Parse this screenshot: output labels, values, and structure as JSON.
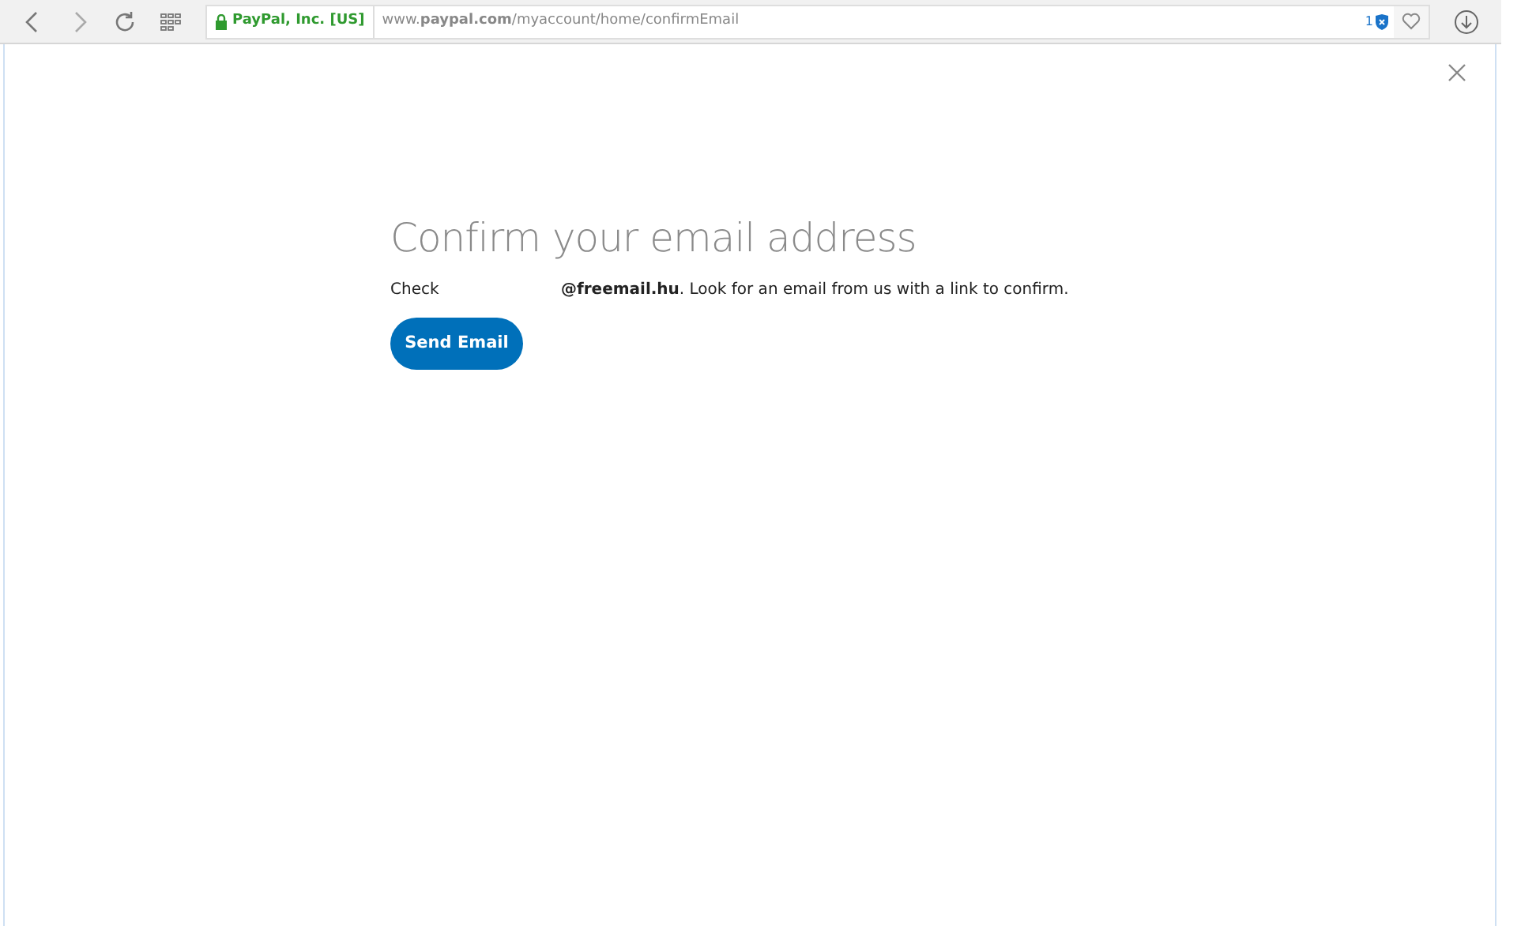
{
  "browser": {
    "security_label": "PayPal, Inc. [US]",
    "url": "www.**paypal.com**/myaccount/home/confirmEmail",
    "badge_count": "1"
  },
  "dialog": {
    "title": "Confirm your email address",
    "check_label": "Check",
    "message": "**@freemail.hu**. Look for an email from us with a link to confirm.",
    "button": "Send Email"
  }
}
